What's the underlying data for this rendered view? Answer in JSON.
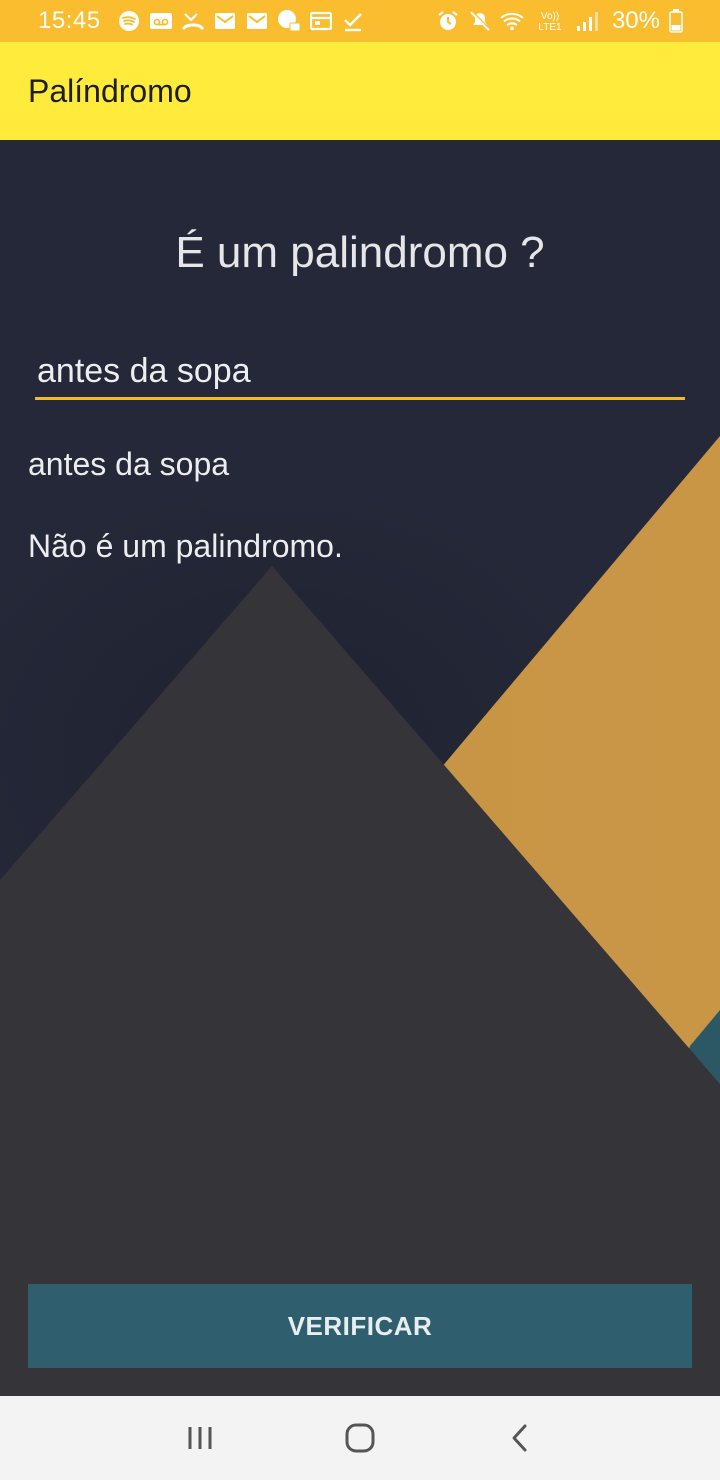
{
  "status_bar": {
    "time": "15:45",
    "battery": "30%",
    "notification_icons": [
      "spotify-icon",
      "voicemail-icon",
      "missed-call-icon",
      "gmail-icon",
      "gmail-icon",
      "chat-icon",
      "calendar-icon",
      "download-done-icon"
    ],
    "system_icons": [
      "alarm-icon",
      "mute-icon",
      "wifi-icon",
      "volte-icon",
      "signal-icon",
      "battery-icon"
    ],
    "volte_label": "Vo)) LTE1"
  },
  "app_bar": {
    "title": "Palíndromo"
  },
  "main": {
    "question": "É um palindromo ?",
    "input": {
      "value": "antes da sopa"
    },
    "echo_text": "antes da sopa",
    "result_text": "Não é um palindromo.",
    "verify_button": "VERIFICAR"
  },
  "nav_bar": {
    "buttons": [
      "recent-apps-icon",
      "home-icon",
      "back-icon"
    ]
  },
  "colors": {
    "status_bar": "#f9bd2f",
    "app_bar": "#ffeb3b",
    "background": "#242838",
    "mountain_dark": "#353438",
    "mountain_gold": "#c79545",
    "accent_teal": "#2f5f6e",
    "input_underline": "#f5b925"
  }
}
